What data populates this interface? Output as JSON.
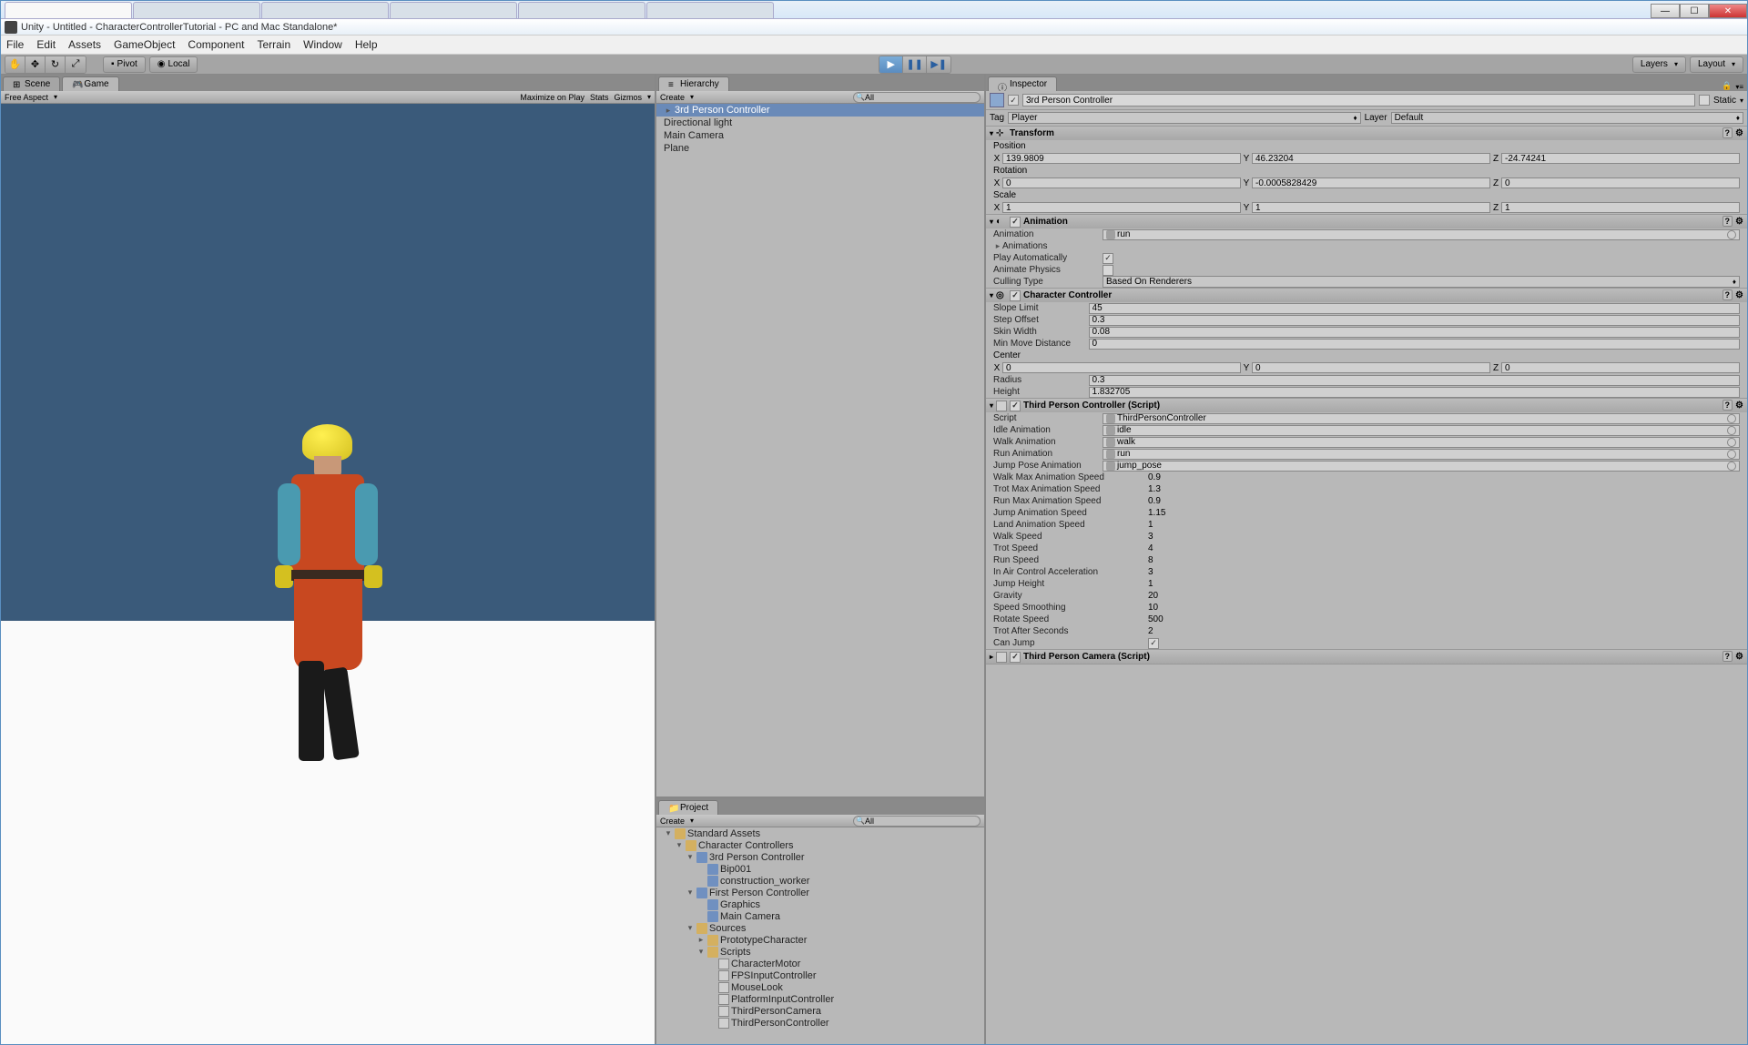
{
  "titlebar": {
    "text": "Unity - Untitled - CharacterControllerTutorial - PC and Mac Standalone*"
  },
  "browser_tabs": [
    "",
    "",
    "",
    "",
    "",
    ""
  ],
  "menubar": [
    "File",
    "Edit",
    "Assets",
    "GameObject",
    "Component",
    "Terrain",
    "Window",
    "Help"
  ],
  "toolbar": {
    "pivot": "Pivot",
    "local": "Local",
    "layers": "Layers",
    "layout": "Layout"
  },
  "scene_tabs": {
    "scene": "Scene",
    "game": "Game"
  },
  "game_toolbar": {
    "aspect": "Free Aspect",
    "maximize": "Maximize on Play",
    "stats": "Stats",
    "gizmos": "Gizmos"
  },
  "hierarchy": {
    "tab": "Hierarchy",
    "create": "Create",
    "search_placeholder": "All",
    "items": [
      "3rd Person Controller",
      "Directional light",
      "Main Camera",
      "Plane"
    ]
  },
  "project": {
    "tab": "Project",
    "create": "Create",
    "search_placeholder": "All",
    "tree": {
      "root": "Standard Assets",
      "cc": "Character Controllers",
      "tpc": "3rd Person Controller",
      "bip": "Bip001",
      "worker": "construction_worker",
      "fpc": "First Person Controller",
      "graphics": "Graphics",
      "maincam": "Main Camera",
      "sources": "Sources",
      "proto": "PrototypeCharacter",
      "scripts": "Scripts",
      "s1": "CharacterMotor",
      "s2": "FPSInputController",
      "s3": "MouseLook",
      "s4": "PlatformInputController",
      "s5": "ThirdPersonCamera",
      "s6": "ThirdPersonController"
    }
  },
  "inspector": {
    "tab": "Inspector",
    "name": "3rd Person Controller",
    "static": "Static",
    "tag_label": "Tag",
    "tag_value": "Player",
    "layer_label": "Layer",
    "layer_value": "Default",
    "transform": {
      "title": "Transform",
      "position_label": "Position",
      "position": {
        "x": "139.9809",
        "y": "46.23204",
        "z": "-24.74241"
      },
      "rotation_label": "Rotation",
      "rotation": {
        "x": "0",
        "y": "-0.0005828429",
        "z": "0"
      },
      "scale_label": "Scale",
      "scale": {
        "x": "1",
        "y": "1",
        "z": "1"
      }
    },
    "animation": {
      "title": "Animation",
      "anim_label": "Animation",
      "anim_value": "run",
      "anims_label": "Animations",
      "play_auto": "Play Automatically",
      "animate_physics": "Animate Physics",
      "culling_label": "Culling Type",
      "culling_value": "Based On Renderers"
    },
    "charctrl": {
      "title": "Character Controller",
      "slope_label": "Slope Limit",
      "slope": "45",
      "step_label": "Step Offset",
      "step": "0.3",
      "skin_label": "Skin Width",
      "skin": "0.08",
      "minmove_label": "Min Move Distance",
      "minmove": "0",
      "center_label": "Center",
      "center": {
        "x": "0",
        "y": "0",
        "z": "0"
      },
      "radius_label": "Radius",
      "radius": "0.3",
      "height_label": "Height",
      "height": "1.832705"
    },
    "tpc_script": {
      "title": "Third Person Controller (Script)",
      "script_label": "Script",
      "script": "ThirdPersonController",
      "idle_label": "Idle Animation",
      "idle": "idle",
      "walk_label": "Walk Animation",
      "walk": "walk",
      "run_label": "Run Animation",
      "run": "run",
      "jump_label": "Jump Pose Animation",
      "jump": "jump_pose",
      "walkmax_label": "Walk Max Animation Speed",
      "walkmax": "0.9",
      "trotmax_label": "Trot Max Animation Speed",
      "trotmax": "1.3",
      "runmax_label": "Run Max Animation Speed",
      "runmax": "0.9",
      "jumpspeed_label": "Jump Animation Speed",
      "jumpspeed": "1.15",
      "landspeed_label": "Land Animation Speed",
      "landspeed": "1",
      "walkspeed_label": "Walk Speed",
      "walkspeed": "3",
      "trotspeed_label": "Trot Speed",
      "trotspeed": "4",
      "runspeed_label": "Run Speed",
      "runspeed": "8",
      "aircontrol_label": "In Air Control Acceleration",
      "aircontrol": "3",
      "jumpheight_label": "Jump Height",
      "jumpheight": "1",
      "gravity_label": "Gravity",
      "gravity": "20",
      "smooth_label": "Speed Smoothing",
      "smooth": "10",
      "rotspeed_label": "Rotate Speed",
      "rotspeed": "500",
      "trotafter_label": "Trot After Seconds",
      "trotafter": "2",
      "canjump_label": "Can Jump"
    },
    "tpcamera": {
      "title": "Third Person Camera (Script)"
    }
  }
}
